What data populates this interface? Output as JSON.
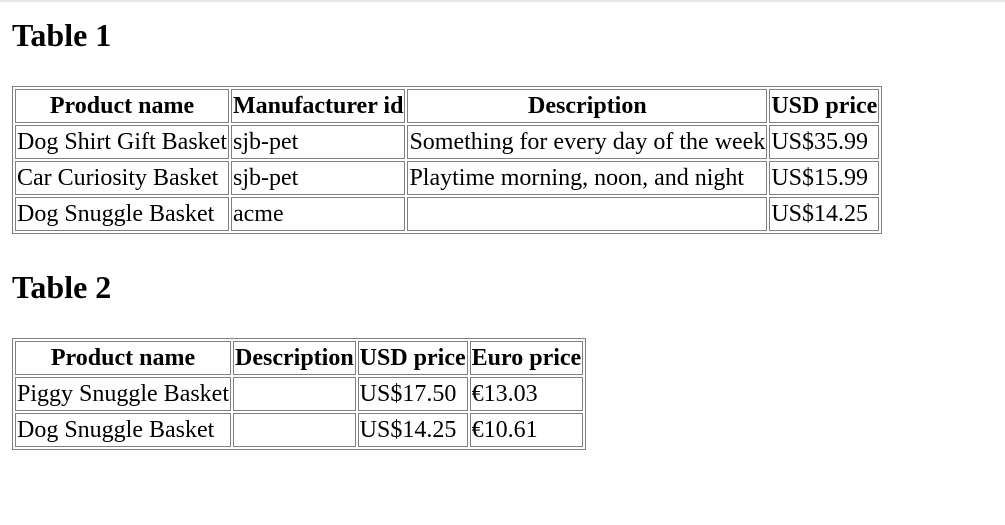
{
  "table1": {
    "title": "Table 1",
    "headers": [
      "Product name",
      "Manufacturer id",
      "Description",
      "USD price"
    ],
    "rows": [
      [
        "Dog Shirt Gift Basket",
        "sjb-pet",
        "Something for every day of the week",
        "US$35.99"
      ],
      [
        "Car Curiosity Basket",
        "sjb-pet",
        "Playtime morning, noon, and night",
        "US$15.99"
      ],
      [
        "Dog Snuggle Basket",
        "acme",
        "",
        "US$14.25"
      ]
    ]
  },
  "table2": {
    "title": "Table 2",
    "headers": [
      "Product name",
      "Description",
      "USD price",
      "Euro price"
    ],
    "rows": [
      [
        "Piggy Snuggle Basket",
        "",
        "US$17.50",
        "€13.03"
      ],
      [
        "Dog Snuggle Basket",
        "",
        "US$14.25",
        "€10.61"
      ]
    ]
  }
}
